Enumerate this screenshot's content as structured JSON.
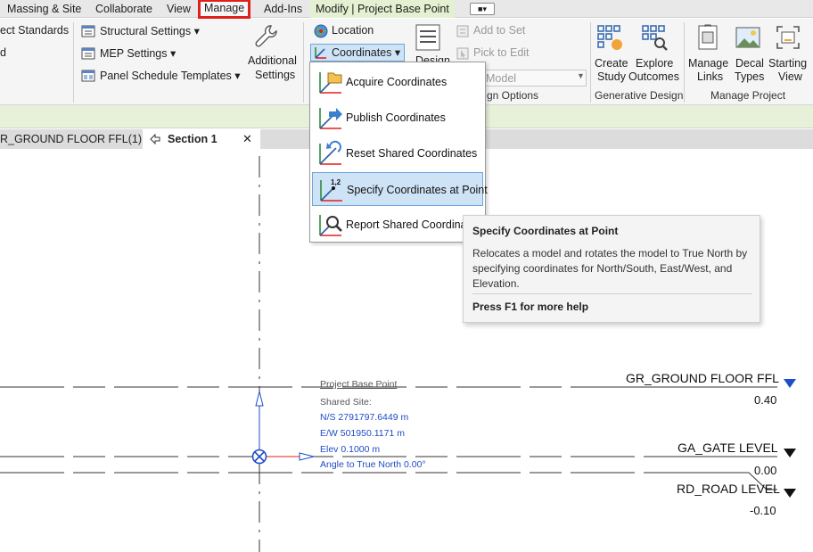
{
  "ribbon_tabs": {
    "massing": "Massing & Site",
    "collaborate": "Collaborate",
    "view": "View",
    "manage": "Manage",
    "addins": "Add-Ins",
    "context": "Modify | Project Base Point",
    "extra": "■▾"
  },
  "ribbon": {
    "project_standards": "ect Standards",
    "d_cut": "d",
    "structural_settings": "Structural  Settings ▾",
    "mep_settings": "MEP  Settings ▾",
    "panel_schedule_templates": "Panel Schedule  Templates ▾",
    "additional_settings_line1": "Additional",
    "additional_settings_line2": "Settings",
    "location": "Location",
    "coordinates": "Coordinates ▾",
    "design_cut": "Design",
    "add_to_set": "Add to Set",
    "pick_to_edit": "Pick to Edit",
    "model_cut": "Model",
    "design_options_cut": "gn Options",
    "create_study_line1": "Create",
    "create_study_line2": "Study",
    "explore_outcomes_line1": "Explore",
    "explore_outcomes_line2": "Outcomes",
    "generative_design": "Generative Design",
    "manage_links_line1": "Manage",
    "manage_links_line2": "Links",
    "decal_types_line1": "Decal",
    "decal_types_line2": "Types",
    "starting_view_line1": "Starting",
    "starting_view_line2": "View",
    "manage_project": "Manage Project"
  },
  "view_tabs": {
    "floor_tab": "R_GROUND FLOOR FFL(1)",
    "section_tab": "Section 1",
    "close": "✕"
  },
  "coordinates_menu": {
    "items": [
      {
        "label": "Acquire Coordinates"
      },
      {
        "label": "Publish Coordinates"
      },
      {
        "label": "Reset Shared Coordinates"
      },
      {
        "label": "Specify Coordinates at Point"
      },
      {
        "label": "Report Shared Coordinat"
      }
    ],
    "highlight_index": 3
  },
  "tooltip": {
    "title": "Specify Coordinates at Point",
    "body": "Relocates a model and rotates the model to True North by specifying coordinates for North/South, East/West, and Elevation.",
    "help": "Press F1 for more help"
  },
  "base_point": {
    "title": "Project Base Point",
    "shared_site": "Shared Site:",
    "ns": "N/S  2791797.6449 m",
    "ew": "E/W  501950.1171 m",
    "elev": "Elev  0.1000 m",
    "angle": "Angle to True North  0.00°"
  },
  "levels": [
    {
      "name": "GR_GROUND FLOOR FFL",
      "value": "0.40",
      "color": "#1f4cc7"
    },
    {
      "name": "GA_GATE LEVEL",
      "value": "0.00",
      "color": "#111111"
    },
    {
      "name": "RD_ROAD LEVEL",
      "value": "-0.10",
      "color": "#111111"
    }
  ],
  "colors": {
    "accent_red": "#e0201d",
    "selection_blue": "#cfe3f7",
    "annotation_blue": "#1f4cc7",
    "context_green": "#e4f0d2"
  }
}
